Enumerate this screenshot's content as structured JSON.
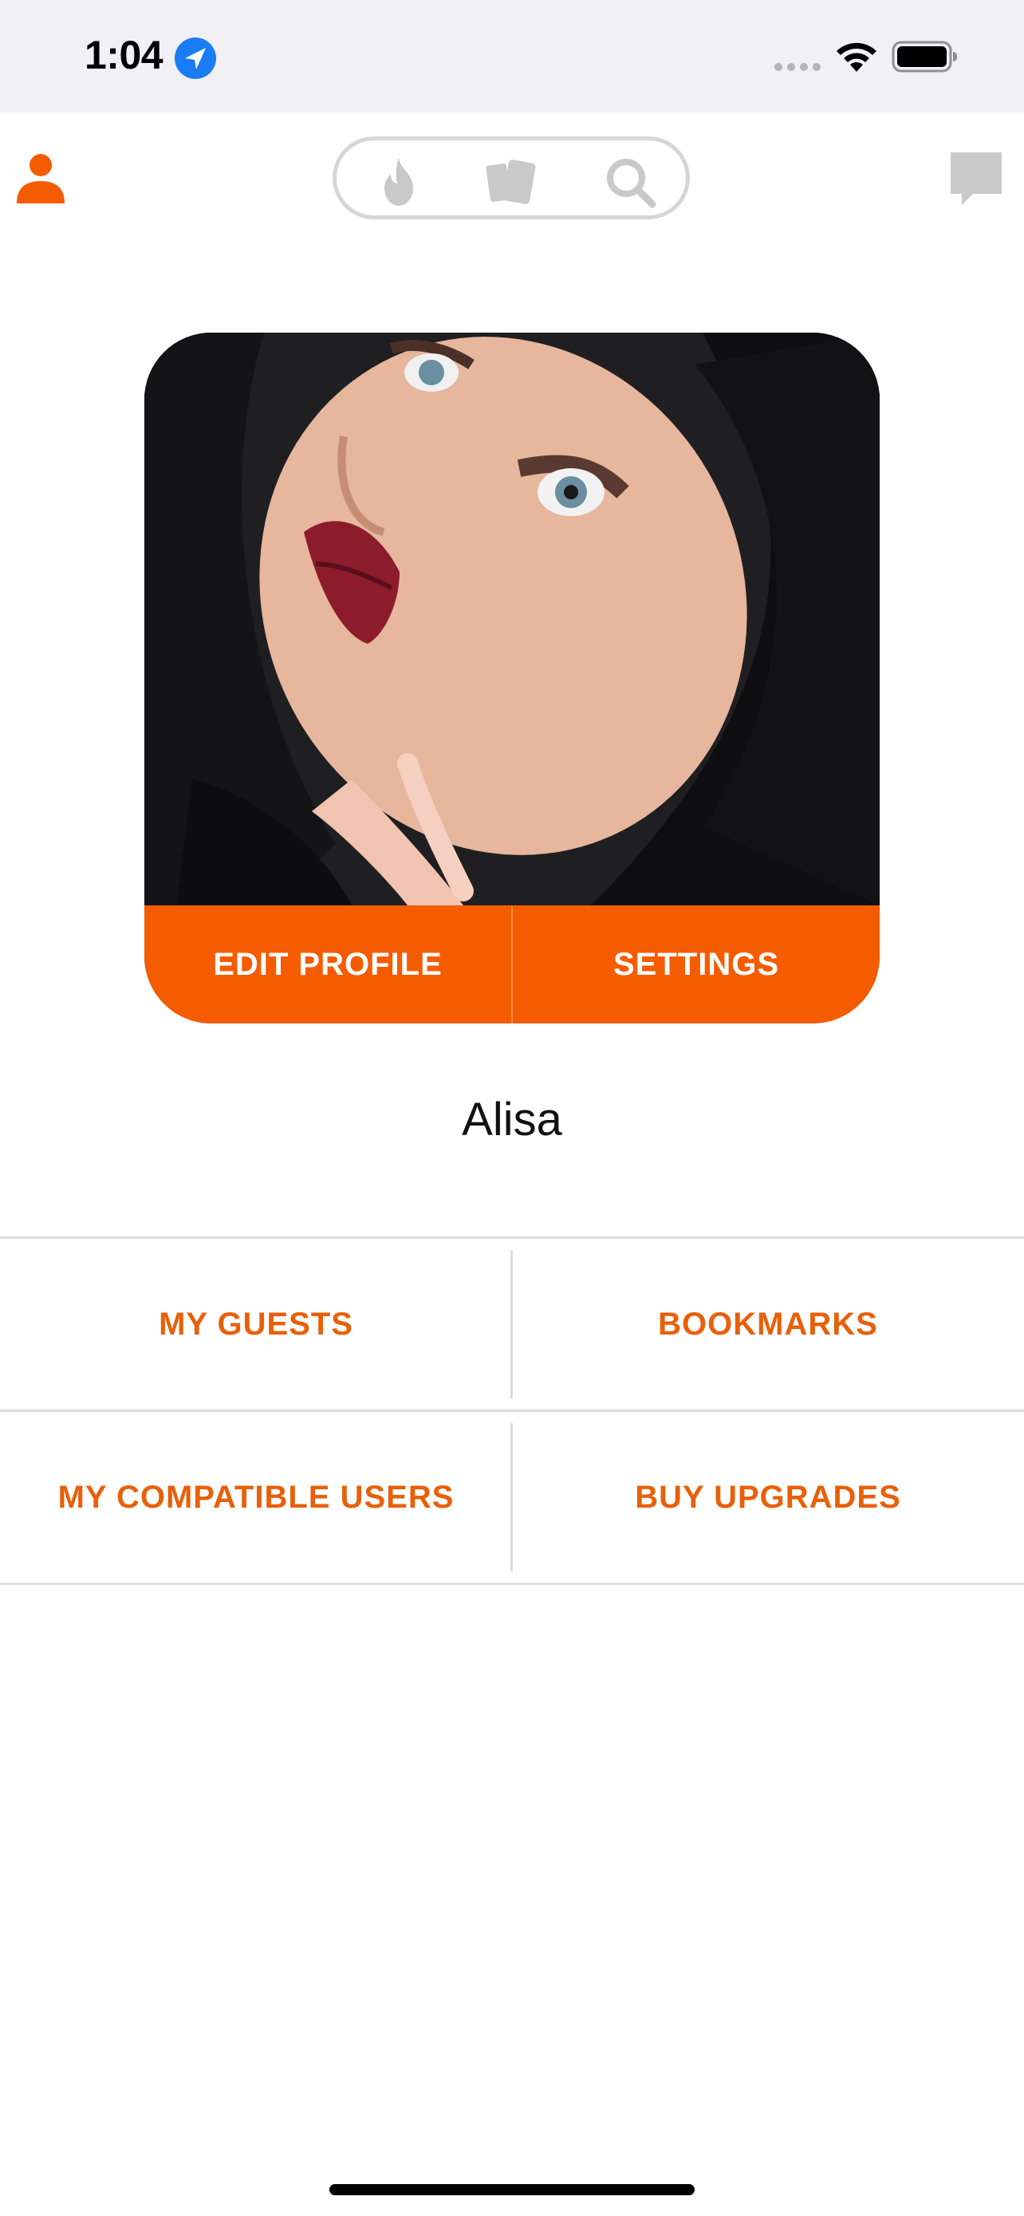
{
  "status_bar": {
    "time": "1:04"
  },
  "nav": {
    "profile_icon": "person-icon",
    "pill_icons": [
      "flame-icon",
      "cards-icon",
      "search-icon"
    ],
    "chat_icon": "chat-bubble-icon"
  },
  "profile": {
    "name": "Alisa",
    "edit_label": "EDIT PROFILE",
    "settings_label": "SETTINGS"
  },
  "menu": {
    "rows": [
      {
        "left": "MY GUESTS",
        "right": "BOOKMARKS"
      },
      {
        "left": "MY COMPATIBLE USERS",
        "right": "BUY UPGRADES"
      }
    ]
  },
  "colors": {
    "accent": "#f55c00",
    "menu_text": "#e8600a",
    "icon_inactive": "#c9c9c9",
    "status_bg": "#f0f0f5",
    "location_blue": "#1a7cf5"
  }
}
